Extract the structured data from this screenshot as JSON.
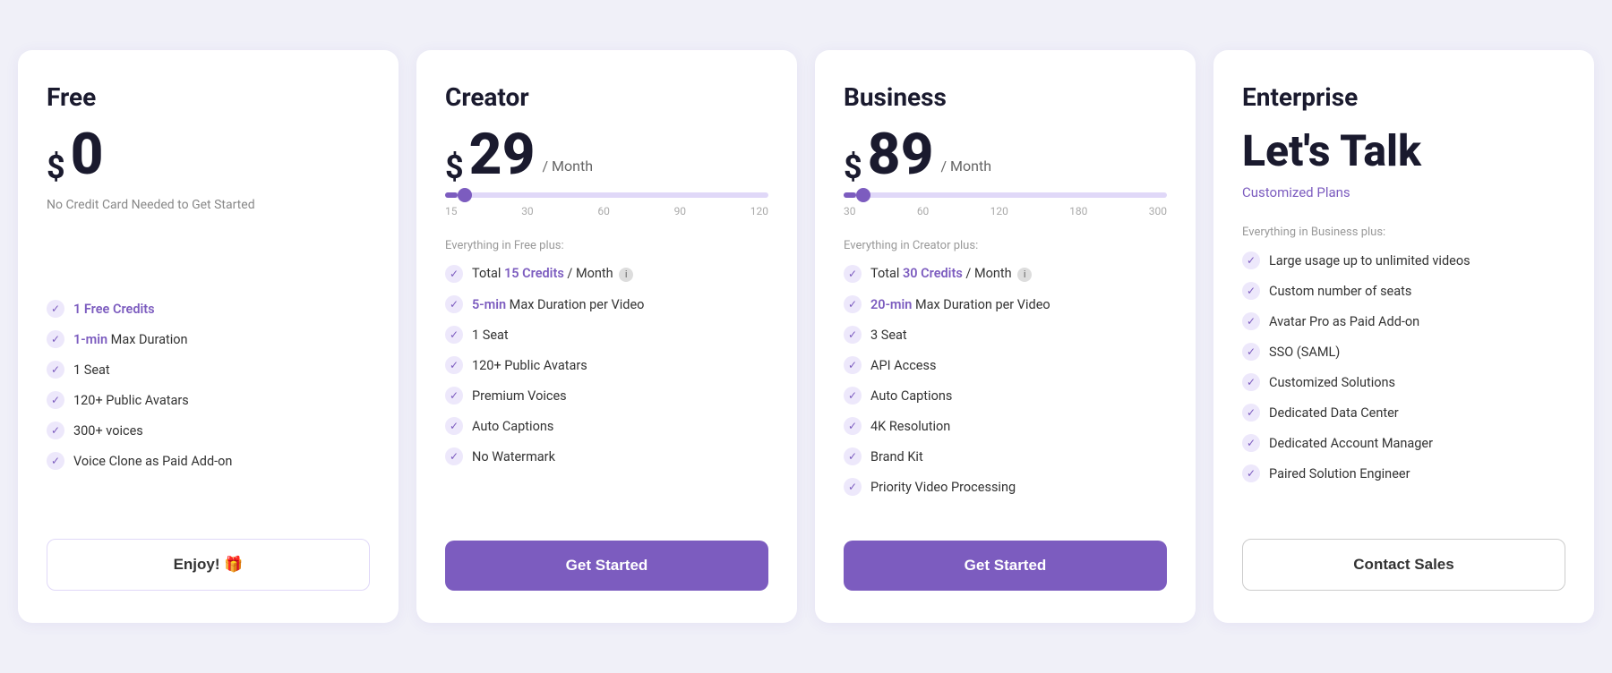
{
  "plans": [
    {
      "id": "free",
      "title": "Free",
      "price_symbol": "$",
      "price_amount": "0",
      "price_period": null,
      "price_subtitle": "No Credit Card Needed to Get Started",
      "slider": null,
      "section_label": null,
      "features": [
        {
          "text": "1 Free Credits",
          "highlight": "1 Free Credits"
        },
        {
          "text": "1-min Max Duration",
          "highlight": null
        },
        {
          "text": "1 Seat",
          "highlight": null
        },
        {
          "text": "120+ Public Avatars",
          "highlight": null
        },
        {
          "text": "300+ voices",
          "highlight": null
        },
        {
          "text": "Voice Clone as Paid Add-on",
          "highlight": null
        }
      ],
      "cta_label": "Enjoy! 🎁",
      "cta_style": "ghost"
    },
    {
      "id": "creator",
      "title": "Creator",
      "price_symbol": "$",
      "price_amount": "29",
      "price_period": "/ Month",
      "price_subtitle": null,
      "slider": {
        "fill_pct": 4,
        "thumb_pct": 4,
        "labels": [
          "15",
          "30",
          "60",
          "90",
          "120"
        ]
      },
      "section_label": "Everything in Free plus:",
      "features": [
        {
          "text": "Total 15 Credits / Month",
          "highlight": "15 Credits",
          "info": true
        },
        {
          "text": "5-min Max Duration per Video",
          "highlight": "5-min"
        },
        {
          "text": "1 Seat",
          "highlight": null
        },
        {
          "text": "120+ Public Avatars",
          "highlight": null
        },
        {
          "text": "Premium Voices",
          "highlight": null
        },
        {
          "text": "Auto Captions",
          "highlight": null
        },
        {
          "text": "No Watermark",
          "highlight": null
        }
      ],
      "cta_label": "Get Started",
      "cta_style": "primary"
    },
    {
      "id": "business",
      "title": "Business",
      "price_symbol": "$",
      "price_amount": "89",
      "price_period": "/ Month",
      "price_subtitle": null,
      "slider": {
        "fill_pct": 4,
        "thumb_pct": 4,
        "labels": [
          "30",
          "60",
          "120",
          "180",
          "300"
        ]
      },
      "section_label": "Everything in Creator plus:",
      "features": [
        {
          "text": "Total 30 Credits / Month",
          "highlight": "30 Credits",
          "info": true
        },
        {
          "text": "20-min Max Duration per Video",
          "highlight": "20-min"
        },
        {
          "text": "3 Seat",
          "highlight": null
        },
        {
          "text": "API Access",
          "highlight": null
        },
        {
          "text": "Auto Captions",
          "highlight": null
        },
        {
          "text": "4K Resolution",
          "highlight": null
        },
        {
          "text": "Brand Kit",
          "highlight": null
        },
        {
          "text": "Priority Video Processing",
          "highlight": null
        }
      ],
      "cta_label": "Get Started",
      "cta_style": "primary"
    },
    {
      "id": "enterprise",
      "title": "Enterprise",
      "price_display": "Let's Talk",
      "price_subtitle": "Customized Plans",
      "slider": null,
      "section_label": "Everything in Business plus:",
      "features": [
        {
          "text": "Large usage up to unlimited videos",
          "highlight": null
        },
        {
          "text": "Custom number of seats",
          "highlight": null
        },
        {
          "text": "Avatar Pro as Paid Add-on",
          "highlight": null
        },
        {
          "text": "SSO (SAML)",
          "highlight": null
        },
        {
          "text": "Customized Solutions",
          "highlight": null
        },
        {
          "text": "Dedicated Data Center",
          "highlight": null
        },
        {
          "text": "Dedicated Account Manager",
          "highlight": null
        },
        {
          "text": "Paired Solution Engineer",
          "highlight": null
        }
      ],
      "cta_label": "Contact Sales",
      "cta_style": "outline"
    }
  ]
}
